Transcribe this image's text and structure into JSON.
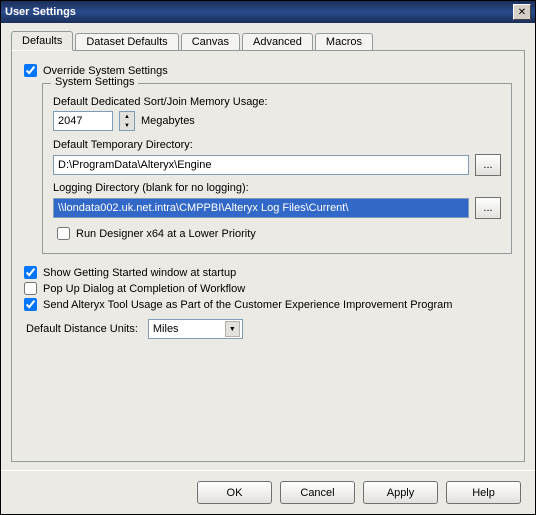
{
  "window": {
    "title": "User Settings"
  },
  "tabs": {
    "defaults": "Defaults",
    "dataset": "Dataset Defaults",
    "canvas": "Canvas",
    "advanced": "Advanced",
    "macros": "Macros"
  },
  "override": {
    "label": "Override System Settings",
    "checked": true
  },
  "system_settings": {
    "legend": "System Settings",
    "mem_label": "Default Dedicated Sort/Join Memory Usage:",
    "mem_value": "2047",
    "mem_unit": "Megabytes",
    "tmp_label": "Default Temporary Directory:",
    "tmp_value": "D:\\ProgramData\\Alteryx\\Engine",
    "log_label": "Logging Directory (blank for no logging):",
    "log_value": "\\\\londata002.uk.net.intra\\CMPPBI\\Alteryx Log Files\\Current\\",
    "lowprio": {
      "label": "Run Designer x64 at a Lower Priority",
      "checked": false
    },
    "browse": "..."
  },
  "opts": {
    "getstarted": {
      "label": "Show Getting Started window at startup",
      "checked": true
    },
    "popup": {
      "label": "Pop Up Dialog at Completion of Workflow",
      "checked": false
    },
    "telemetry": {
      "label": "Send Alteryx Tool Usage as Part of the Customer Experience Improvement Program",
      "checked": true
    }
  },
  "units": {
    "label": "Default Distance Units:",
    "value": "Miles"
  },
  "buttons": {
    "ok": "OK",
    "cancel": "Cancel",
    "apply": "Apply",
    "help": "Help"
  }
}
